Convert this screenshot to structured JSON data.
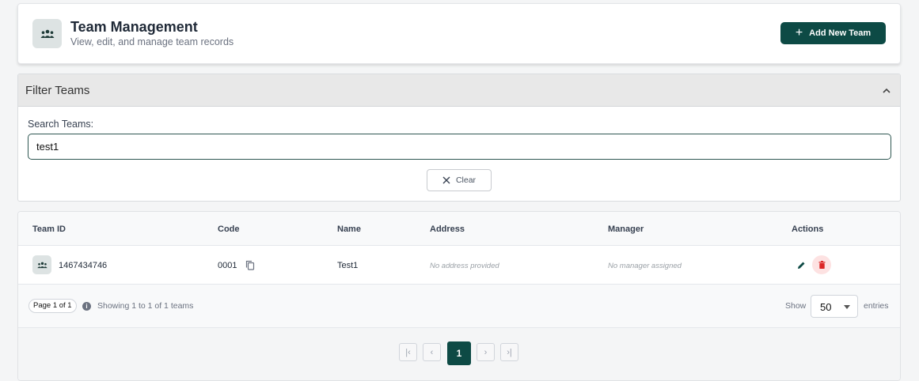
{
  "header": {
    "title": "Team Management",
    "subtitle": "View, edit, and manage team records",
    "add_button_label": "Add New Team"
  },
  "filter": {
    "title": "Filter Teams",
    "search_label": "Search Teams:",
    "search_value": "test1",
    "clear_label": "Clear"
  },
  "table": {
    "columns": [
      "Team ID",
      "Code",
      "Name",
      "Address",
      "Manager",
      "Actions"
    ],
    "rows": [
      {
        "team_id": "1467434746",
        "code": "0001",
        "name": "Test1",
        "address": "No address provided",
        "manager": "No manager assigned"
      }
    ]
  },
  "footer": {
    "page_badge": "Page 1 of 1",
    "showing_text": "Showing 1 to 1 of 1 teams",
    "show_label": "Show",
    "page_size": "50",
    "entries_label": "entries"
  },
  "pagination": {
    "current_page": "1",
    "first_label": "|‹",
    "prev_label": "‹",
    "next_label": "›",
    "last_label": "›|"
  },
  "colors": {
    "primary": "#0d4a45",
    "danger": "#dc2626",
    "danger_bg": "#fde2e2"
  }
}
